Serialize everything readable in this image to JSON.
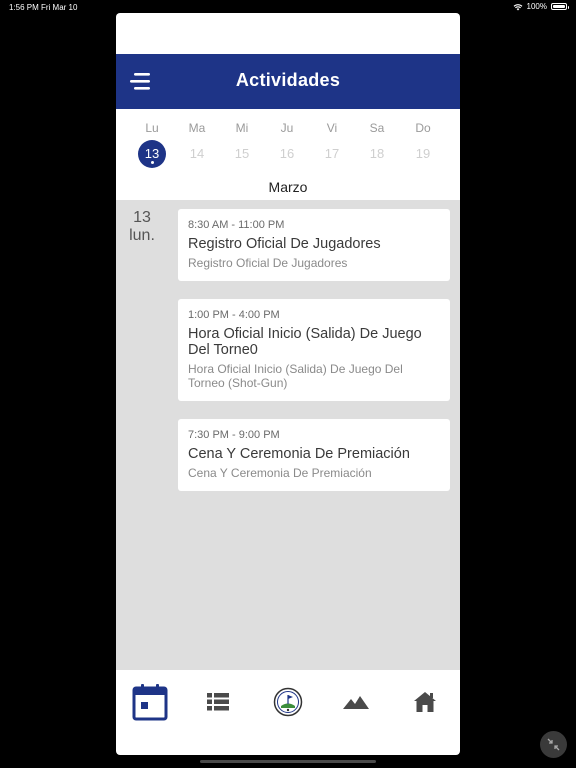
{
  "status": {
    "time": "1:56 PM",
    "date": "Fri Mar 10",
    "battery": "100%"
  },
  "header": {
    "title": "Actividades"
  },
  "week": {
    "days": [
      {
        "name": "Lu",
        "num": "13",
        "selected": true
      },
      {
        "name": "Ma",
        "num": "14",
        "selected": false
      },
      {
        "name": "Mi",
        "num": "15",
        "selected": false
      },
      {
        "name": "Ju",
        "num": "16",
        "selected": false
      },
      {
        "name": "Vi",
        "num": "17",
        "selected": false
      },
      {
        "name": "Sa",
        "num": "18",
        "selected": false
      },
      {
        "name": "Do",
        "num": "19",
        "selected": false
      }
    ],
    "month": "Marzo"
  },
  "agenda": {
    "date_num": "13",
    "date_weekday": "lun.",
    "events": [
      {
        "time": "8:30 AM - 11:00 PM",
        "title": "Registro Oficial De Jugadores",
        "subtitle": "Registro Oficial De Jugadores"
      },
      {
        "time": "1:00 PM - 4:00 PM",
        "title": "Hora Oficial Inicio (Salida) De Juego Del Torne0",
        "subtitle": "Hora Oficial Inicio (Salida) De Juego Del Torneo (Shot-Gun)"
      },
      {
        "time": "7:30 PM - 9:00 PM",
        "title": "Cena Y Ceremonia De Premiación",
        "subtitle": "Cena Y Ceremonia De Premiación"
      }
    ]
  },
  "tabs": [
    {
      "icon": "calendar-icon",
      "active": true
    },
    {
      "icon": "list-icon",
      "active": false
    },
    {
      "icon": "tournament-logo-icon",
      "active": false
    },
    {
      "icon": "mountain-icon",
      "active": false
    },
    {
      "icon": "home-icon",
      "active": false
    }
  ],
  "colors": {
    "primary": "#1e3487",
    "background": "#dedede",
    "icon": "#4a4a4a"
  }
}
